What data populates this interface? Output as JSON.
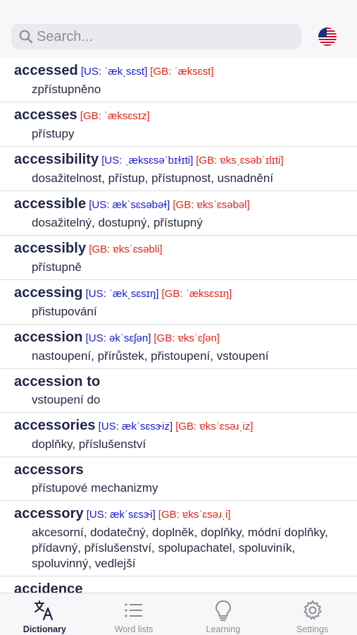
{
  "search": {
    "placeholder": "Search..."
  },
  "entries": [
    {
      "word": "accessed",
      "us": "[US: ˈæk͵sɛst]",
      "gb": "[GB: ˈæksɛst]",
      "translation": "zpřístupněno"
    },
    {
      "word": "accesses",
      "us": "",
      "gb": "[GB: ˈæksɛsɪz]",
      "translation": "přístupy"
    },
    {
      "word": "accessibility",
      "us": "[US: ˌæksɛsəˈbɪɫɪti]",
      "gb": "[GB: ɐksˌɛsəbˈɪlɪti]",
      "translation": "dosažitelnost, přístup, přístupnost, usnadnění"
    },
    {
      "word": "accessible",
      "us": "[US: ækˈsɛsəbəɫ]",
      "gb": "[GB: ɐksˈɛsəbəl]",
      "translation": "dosažitelný, dostupný, přístupný"
    },
    {
      "word": "accessibly",
      "us": "",
      "gb": "[GB: ɐksˈɛsəbli]",
      "translation": "přístupně"
    },
    {
      "word": "accessing",
      "us": "[US: ˈæk͵sɛsɪŋ]",
      "gb": "[GB: ˈæksɛsɪŋ]",
      "translation": "přistupování"
    },
    {
      "word": "accession",
      "us": "[US: əkˈsɛʃən]",
      "gb": "[GB: ɐksˈɛʃən]",
      "translation": "nastoupení, přírůstek, přistoupení, vstoupení"
    },
    {
      "word": "accession to",
      "us": "",
      "gb": "",
      "translation": "vstoupení do"
    },
    {
      "word": "accessories",
      "us": "[US: ækˈsɛsɝiz]",
      "gb": "[GB: ɐksˈɛsəɹˌiz]",
      "translation": "doplňky, příslušenství"
    },
    {
      "word": "accessors",
      "us": "",
      "gb": "",
      "translation": "přístupové mechanizmy"
    },
    {
      "word": "accessory",
      "us": "[US: ækˈsɛsɝi]",
      "gb": "[GB: ɐksˈɛsəɹˌi]",
      "translation": "akcesorní, dodatečný, doplněk, doplňky, módní doplňky, přídavný, příslušenství, spolupachatel, spoluviník, spoluvinný, vedlejší"
    },
    {
      "word": "accidence",
      "us": "",
      "gb": "",
      "translation": ""
    }
  ],
  "tabs": [
    {
      "label": "Dictionary",
      "icon": "dictionary-translate-icon",
      "active": true
    },
    {
      "label": "Word lists",
      "icon": "list-icon",
      "active": false
    },
    {
      "label": "Learning",
      "icon": "lightbulb-icon",
      "active": false
    },
    {
      "label": "Settings",
      "icon": "gear-icon",
      "active": false
    }
  ],
  "colors": {
    "us_pron": "#1a1ad0",
    "gb_pron": "#e0271e",
    "header_bg": "#f7f7f9",
    "active_tab": "#1c2340",
    "inactive_tab": "#8e8e93"
  }
}
